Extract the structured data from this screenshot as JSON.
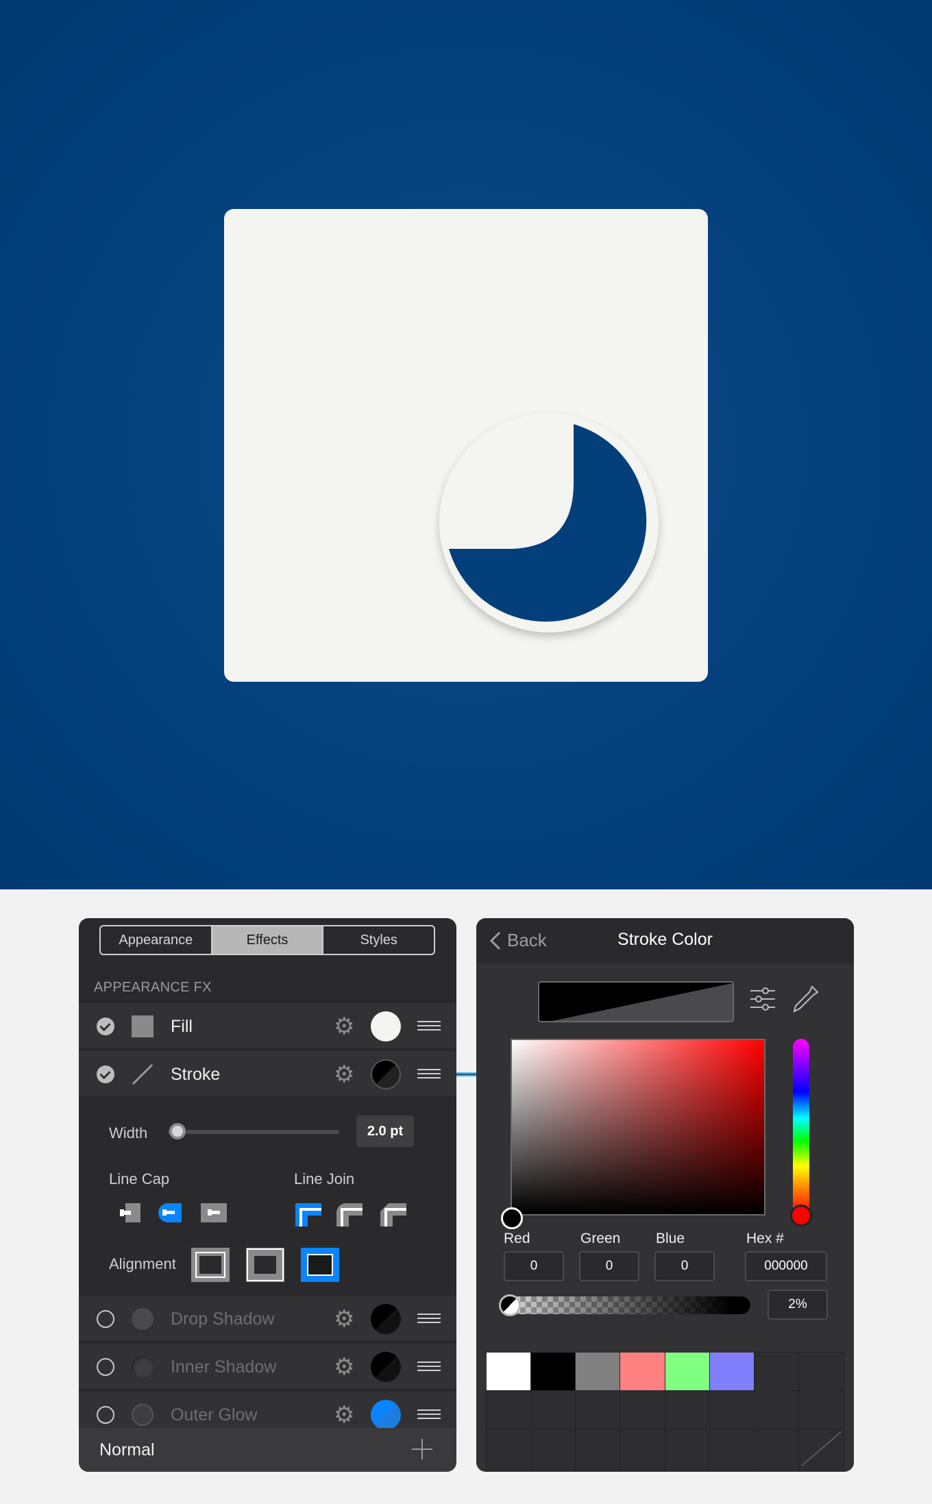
{
  "appearance_panel": {
    "tabs": [
      "Appearance",
      "Effects",
      "Styles"
    ],
    "active_tab": "Effects",
    "section_label": "APPEARANCE FX",
    "rows": [
      {
        "label": "Fill",
        "enabled": true,
        "swatch": "#f4f4f1",
        "thumb": "fill-square"
      },
      {
        "label": "Stroke",
        "enabled": true,
        "swatch": "#000000",
        "thumb": "stroke-line"
      },
      {
        "label": "Drop Shadow",
        "enabled": false,
        "swatch": "#000000"
      },
      {
        "label": "Inner Shadow",
        "enabled": false,
        "swatch": "#000000"
      },
      {
        "label": "Outer Glow",
        "enabled": false,
        "swatch": "#0a84ff"
      }
    ],
    "stroke": {
      "width_label": "Width",
      "width_value": "2.0 pt",
      "line_cap_label": "Line Cap",
      "line_join_label": "Line Join",
      "alignment_label": "Alignment",
      "selected_cap": "round",
      "selected_join": "miter",
      "selected_alignment": "outside"
    },
    "blend_mode": "Normal"
  },
  "stroke_color_panel": {
    "back_label": "Back",
    "title": "Stroke Color",
    "channels": [
      {
        "label": "Red",
        "value": "0"
      },
      {
        "label": "Green",
        "value": "0"
      },
      {
        "label": "Blue",
        "value": "0"
      }
    ],
    "hex_label": "Hex #",
    "hex_value": "000000",
    "opacity": "2%",
    "swatches": [
      "#ffffff",
      "#000000",
      "#808080",
      "#ff8080",
      "#80ff80",
      "#8080ff"
    ]
  },
  "colors": {
    "canvas_bg": "#05427e",
    "artboard": "#f4f4f1",
    "accent": "#0a84ff",
    "shape_blue": "#033f7b"
  }
}
